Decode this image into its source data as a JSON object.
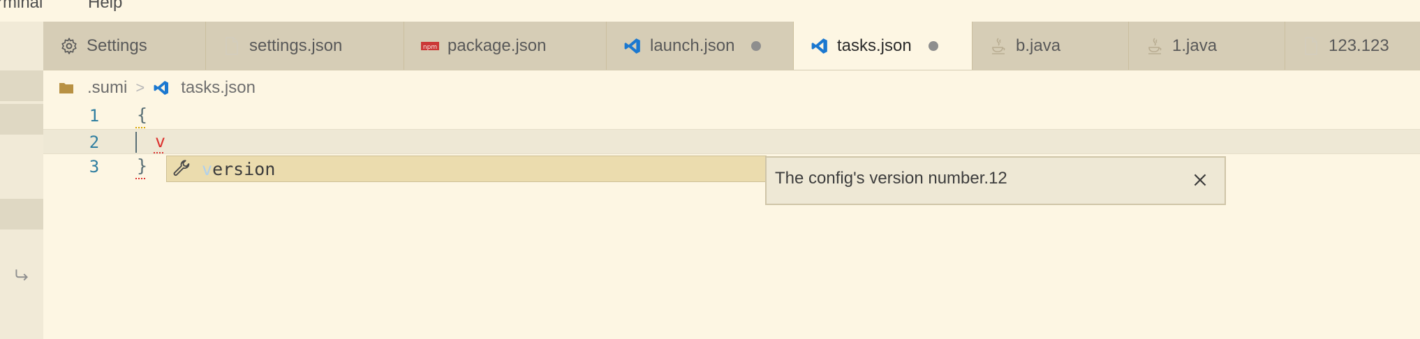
{
  "menu": {
    "items": [
      "rminal",
      "Help"
    ]
  },
  "tabs": [
    {
      "label": "Settings",
      "icon": "gear-icon",
      "dirty": false,
      "active": false
    },
    {
      "label": "settings.json",
      "icon": "file-icon",
      "dirty": false,
      "active": false
    },
    {
      "label": "package.json",
      "icon": "npm-icon",
      "dirty": false,
      "active": false
    },
    {
      "label": "launch.json",
      "icon": "vscode-icon",
      "dirty": true,
      "active": false
    },
    {
      "label": "tasks.json",
      "icon": "vscode-icon",
      "dirty": true,
      "active": true
    },
    {
      "label": "b.java",
      "icon": "java-icon",
      "dirty": false,
      "active": false
    },
    {
      "label": "1.java",
      "icon": "java-icon",
      "dirty": false,
      "active": false
    },
    {
      "label": "123.123",
      "icon": "file-icon",
      "dirty": false,
      "active": false
    }
  ],
  "breadcrumb": {
    "folder": ".sumi",
    "separator": ">",
    "file": "tasks.json"
  },
  "editor": {
    "lines": [
      {
        "number": "1",
        "text": "{"
      },
      {
        "number": "2",
        "text": "v"
      },
      {
        "number": "3",
        "text": "}"
      }
    ]
  },
  "suggest": {
    "highlight": "v",
    "rest": "ersion",
    "icon": "wrench-icon"
  },
  "details": {
    "text": "The config's version number.12",
    "close_icon": "close-icon"
  },
  "colors": {
    "background": "#fdf6e3",
    "tabbar": "#d6cdb6",
    "error": "#dc322f",
    "line_number": "#2f7ea0",
    "vscode_blue": "#1b78d0"
  }
}
